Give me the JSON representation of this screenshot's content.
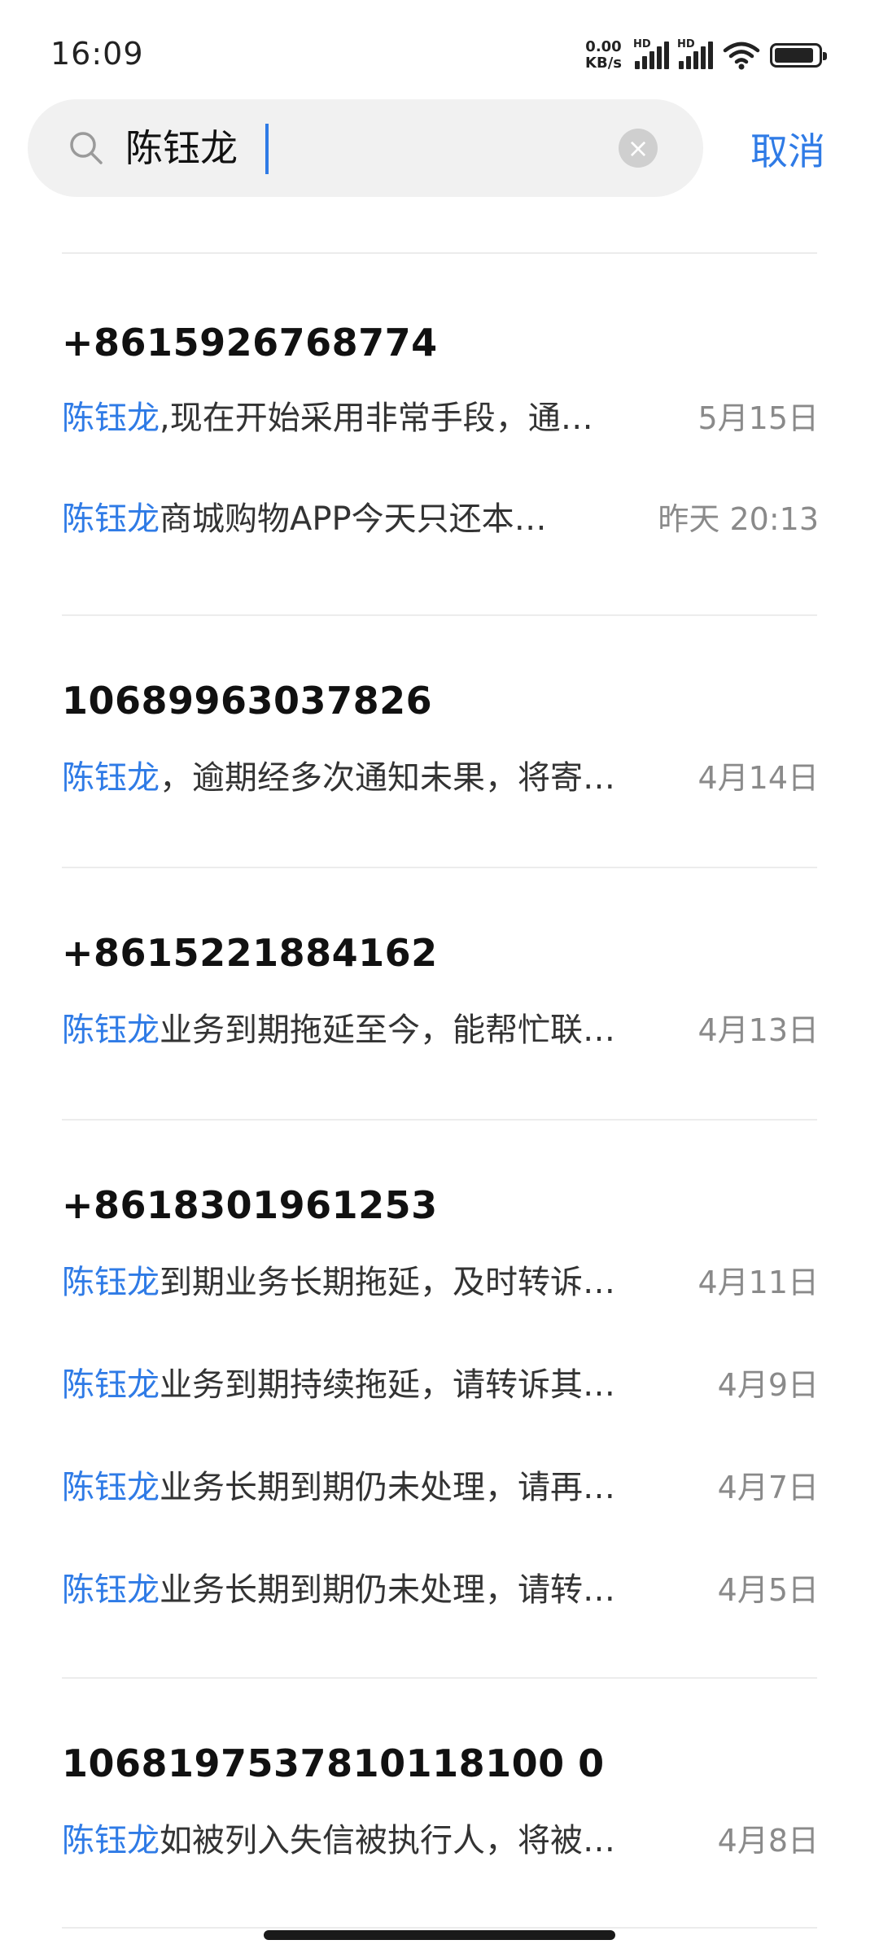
{
  "status_bar": {
    "time": "16:09",
    "net_speed_value": "0.00",
    "net_speed_unit": "KB/s",
    "hd_label": "HD"
  },
  "search": {
    "query": "陈钰龙",
    "clear_symbol": "×",
    "cancel_label": "取消"
  },
  "colors": {
    "accent": "#2f7be6",
    "date_gray": "#8a8a8a"
  },
  "groups": [
    {
      "sender": "+8615926768774",
      "messages": [
        {
          "highlight": "陈钰龙",
          "rest": ",现在开始采用非常手段，通…",
          "date": "5月15日"
        },
        {
          "highlight": "陈钰龙",
          "rest": "商城购物APP今天只还本…",
          "date": "昨天 20:13"
        }
      ]
    },
    {
      "sender": "10689963037826",
      "messages": [
        {
          "highlight": "陈钰龙",
          "rest": "，逾期经多次通知未果，将寄…",
          "date": "4月14日"
        }
      ]
    },
    {
      "sender": "+8615221884162",
      "messages": [
        {
          "highlight": "陈钰龙",
          "rest": "业务到期拖延至今，能帮忙联…",
          "date": "4月13日"
        }
      ]
    },
    {
      "sender": "+8618301961253",
      "messages": [
        {
          "highlight": "陈钰龙",
          "rest": "到期业务长期拖延，及时转诉…",
          "date": "4月11日"
        },
        {
          "highlight": "陈钰龙",
          "rest": "业务到期持续拖延，请转诉其…",
          "date": "4月9日"
        },
        {
          "highlight": "陈钰龙",
          "rest": "业务长期到期仍未处理，请再…",
          "date": "4月7日"
        },
        {
          "highlight": "陈钰龙",
          "rest": "业务长期到期仍未处理，请转…",
          "date": "4月5日"
        }
      ]
    },
    {
      "sender": "1068197537810118100 0",
      "messages": [
        {
          "highlight": "陈钰龙",
          "rest": "如被列入失信被执行人，将被…",
          "date": "4月8日"
        }
      ]
    }
  ]
}
